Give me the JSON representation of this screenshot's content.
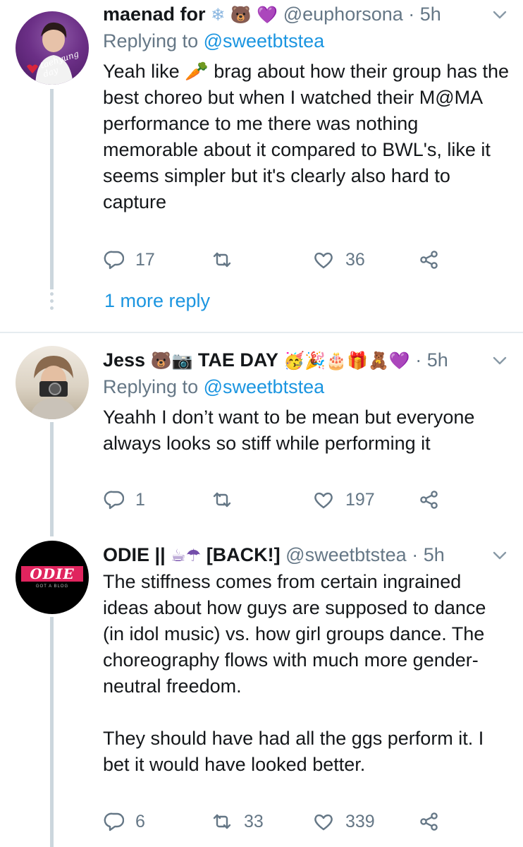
{
  "tweets": [
    {
      "name": "maenad for",
      "name_emojis": "❄ 🐻 💜",
      "handle": "@euphorsona",
      "dot": "·",
      "time": "5h",
      "replying_prefix": "Replying to",
      "replying_to": "@sweetbtstea",
      "text": "Yeah like 🥕 brag about how their group has the best choreo but when I watched their M@MA performance to me there was nothing memorable about it compared to BWL's, like it seems simpler but it's clearly also hard to capture",
      "avatar_text": "taehyung day",
      "replies": "17",
      "retweets": "",
      "likes": "36",
      "more_replies": "1 more reply"
    },
    {
      "name": "Jess",
      "name_emojis": "🐻📷",
      "name2": "TAE DAY",
      "name_emojis2": "🥳🎉🎂🎁🧸💜",
      "handle": "",
      "dot": "·",
      "time": "5h",
      "replying_prefix": "Replying to",
      "replying_to": "@sweetbtstea",
      "text": "Yeahh I don’t want to be mean but everyone always looks so stiff while performing it",
      "replies": "1",
      "retweets": "",
      "likes": "197"
    },
    {
      "name": "ODIE ||",
      "name_emojis": "☕☂",
      "name2": "[BACK!]",
      "handle": "@sweetbtstea",
      "dot": "·",
      "time": "5h",
      "text": "The stiffness comes from certain ingrained ideas about how guys are supposed to dance (in idol music) vs. how girl groups dance. The choreography flows with much more gender-neutral freedom.\n\nThey should have had all the ggs perform it. I bet it would have looked better.",
      "avatar_text": "ODIE",
      "avatar_subtext": "GOT A BLOG",
      "replies": "6",
      "retweets": "33",
      "likes": "339"
    }
  ],
  "icons": {
    "reply": "reply-icon",
    "retweet": "retweet-icon",
    "like": "heart-icon",
    "share": "share-icon",
    "menu": "chevron-down-icon"
  },
  "colors": {
    "link": "#1b95e0",
    "muted": "#657786",
    "text": "#14171a",
    "thread": "#ccd6dd"
  }
}
